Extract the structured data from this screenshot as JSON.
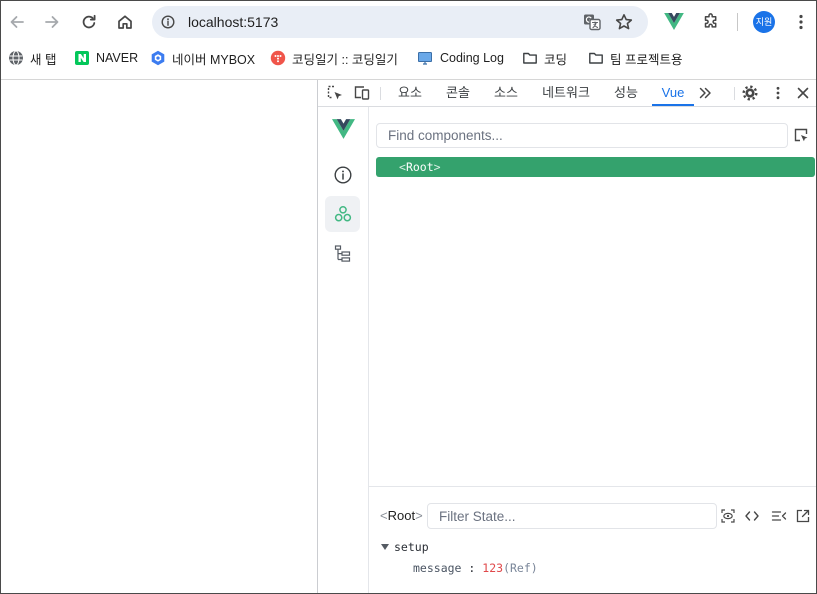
{
  "browser": {
    "address": "localhost:5173",
    "avatar_label": "지원",
    "nav": {
      "back_icon": "arrow-left-icon",
      "forward_icon": "arrow-right-icon",
      "reload_icon": "reload-icon",
      "home_icon": "home-icon"
    },
    "omnibox_icons": [
      "info-icon",
      "translate-icon",
      "star-icon"
    ],
    "extensions": [
      "vue-devtools-icon",
      "puzzle-icon"
    ],
    "bookmarks": [
      {
        "label": "새 탭",
        "icon": "globe-icon"
      },
      {
        "label": "NAVER",
        "icon": "naver-icon"
      },
      {
        "label": "네이버 MYBOX",
        "icon": "mybox-icon"
      },
      {
        "label": "코딩일기 :: 코딩일기",
        "icon": "blog-icon"
      },
      {
        "label": "Coding Log",
        "icon": "monitor-icon"
      },
      {
        "label": "코딩",
        "icon": "folder-icon"
      },
      {
        "label": "팀 프로젝트용",
        "icon": "folder-icon"
      }
    ]
  },
  "devtools": {
    "tabs": [
      {
        "label": "요소"
      },
      {
        "label": "콘솔"
      },
      {
        "label": "소스"
      },
      {
        "label": "네트워크"
      },
      {
        "label": "성능"
      },
      {
        "label": "Vue",
        "active": true
      }
    ],
    "left_icons": [
      "inspect-element-icon",
      "device-toolbar-icon"
    ],
    "right_icons": [
      "more-tabs-icon",
      "settings-icon",
      "kebab-menu-icon",
      "close-icon"
    ]
  },
  "vue": {
    "sidebar_icons": [
      "vue-logo-icon",
      "info-icon",
      "components-icon",
      "timeline-tree-icon"
    ],
    "active_sidebar": "components-icon",
    "search_placeholder": "Find components...",
    "tree": [
      {
        "open": "<",
        "name": "Root",
        "close": ">",
        "selected": true
      }
    ],
    "inspector": {
      "open": "<",
      "name": "Root",
      "close": ">",
      "filter_placeholder": "Filter State...",
      "tool_icons": [
        "scroll-to-component-icon",
        "code-icon",
        "inspect-dom-icon",
        "open-in-editor-icon"
      ],
      "sections": [
        {
          "name": "setup",
          "expanded": true,
          "items": [
            {
              "key": "message",
              "separator": ":",
              "value": "123",
              "type": "(Ref)"
            }
          ]
        }
      ]
    }
  },
  "theme": {
    "accent-blue": "#1a73e8",
    "vue-green": "#42b883",
    "vue-dark": "#35495e",
    "selected-row": "#34a26d",
    "value-red": "#e0484a",
    "ref-gray": "#7a8699",
    "avatar-blue": "#1a73e8"
  }
}
